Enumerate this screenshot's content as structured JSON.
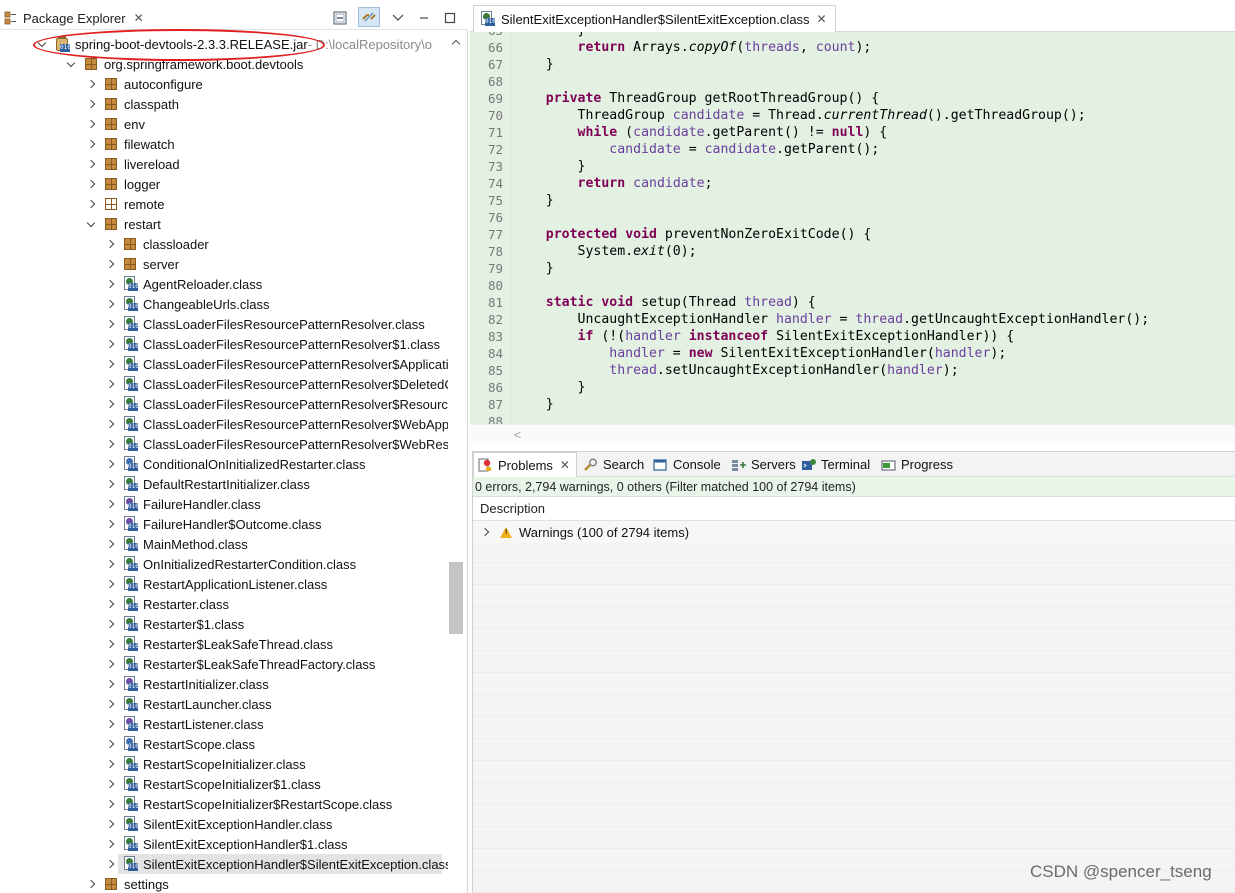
{
  "package_explorer": {
    "title": "Package Explorer",
    "tree": [
      {
        "label": "spring-boot-devtools-2.3.3.RELEASE.jar",
        "suffix": " - D:\\localRepository\\o",
        "icon": "jar-icon",
        "indent": 0,
        "expand": "down"
      },
      {
        "label": "org.springframework.boot.devtools",
        "icon": "package-icon",
        "indent": 1,
        "expand": "down"
      },
      {
        "label": "autoconfigure",
        "icon": "package-icon",
        "indent": 2,
        "expand": "right"
      },
      {
        "label": "classpath",
        "icon": "package-icon",
        "indent": 2,
        "expand": "right"
      },
      {
        "label": "env",
        "icon": "package-icon",
        "indent": 2,
        "expand": "right"
      },
      {
        "label": "filewatch",
        "icon": "package-icon",
        "indent": 2,
        "expand": "right"
      },
      {
        "label": "livereload",
        "icon": "package-icon",
        "indent": 2,
        "expand": "right"
      },
      {
        "label": "logger",
        "icon": "package-icon",
        "indent": 2,
        "expand": "right"
      },
      {
        "label": "remote",
        "icon": "package-empty-icon",
        "indent": 2,
        "expand": "right"
      },
      {
        "label": "restart",
        "icon": "package-icon",
        "indent": 2,
        "expand": "down"
      },
      {
        "label": "classloader",
        "icon": "package-icon",
        "indent": 3,
        "expand": "right"
      },
      {
        "label": "server",
        "icon": "package-icon",
        "indent": 3,
        "expand": "right"
      },
      {
        "label": "AgentReloader.class",
        "icon": "class-file-icon",
        "indent": 3,
        "expand": "right"
      },
      {
        "label": "ChangeableUrls.class",
        "icon": "class-file-icon",
        "indent": 3,
        "expand": "right"
      },
      {
        "label": "ClassLoaderFilesResourcePatternResolver.class",
        "icon": "class-file-icon",
        "indent": 3,
        "expand": "right"
      },
      {
        "label": "ClassLoaderFilesResourcePatternResolver$1.class",
        "icon": "class-file-icon",
        "indent": 3,
        "expand": "right"
      },
      {
        "label": "ClassLoaderFilesResourcePatternResolver$Applicatio",
        "icon": "class-file-icon",
        "indent": 3,
        "expand": "right"
      },
      {
        "label": "ClassLoaderFilesResourcePatternResolver$DeletedCl",
        "icon": "class-file-icon",
        "indent": 3,
        "expand": "right"
      },
      {
        "label": "ClassLoaderFilesResourcePatternResolver$Resource",
        "icon": "class-file-icon",
        "indent": 3,
        "expand": "right"
      },
      {
        "label": "ClassLoaderFilesResourcePatternResolver$WebAppli",
        "icon": "class-file-icon",
        "indent": 3,
        "expand": "right"
      },
      {
        "label": "ClassLoaderFilesResourcePatternResolver$WebReso",
        "icon": "class-file-icon",
        "indent": 3,
        "expand": "right"
      },
      {
        "label": "ConditionalOnInitializedRestarter.class",
        "icon": "annotation-file-icon",
        "indent": 3,
        "expand": "right"
      },
      {
        "label": "DefaultRestartInitializer.class",
        "icon": "class-file-icon",
        "indent": 3,
        "expand": "right"
      },
      {
        "label": "FailureHandler.class",
        "icon": "interface-file-icon",
        "indent": 3,
        "expand": "right"
      },
      {
        "label": "FailureHandler$Outcome.class",
        "icon": "interface-file-icon",
        "indent": 3,
        "expand": "right"
      },
      {
        "label": "MainMethod.class",
        "icon": "class-file-icon",
        "indent": 3,
        "expand": "right"
      },
      {
        "label": "OnInitializedRestarterCondition.class",
        "icon": "class-file-icon",
        "indent": 3,
        "expand": "right"
      },
      {
        "label": "RestartApplicationListener.class",
        "icon": "class-file-icon",
        "indent": 3,
        "expand": "right"
      },
      {
        "label": "Restarter.class",
        "icon": "class-file-icon",
        "indent": 3,
        "expand": "right"
      },
      {
        "label": "Restarter$1.class",
        "icon": "class-file-icon",
        "indent": 3,
        "expand": "right"
      },
      {
        "label": "Restarter$LeakSafeThread.class",
        "icon": "class-file-icon",
        "indent": 3,
        "expand": "right"
      },
      {
        "label": "Restarter$LeakSafeThreadFactory.class",
        "icon": "class-file-icon",
        "indent": 3,
        "expand": "right"
      },
      {
        "label": "RestartInitializer.class",
        "icon": "interface-file-icon",
        "indent": 3,
        "expand": "right"
      },
      {
        "label": "RestartLauncher.class",
        "icon": "class-file-icon",
        "indent": 3,
        "expand": "right"
      },
      {
        "label": "RestartListener.class",
        "icon": "interface-file-icon",
        "indent": 3,
        "expand": "right"
      },
      {
        "label": "RestartScope.class",
        "icon": "annotation-file-icon",
        "indent": 3,
        "expand": "right"
      },
      {
        "label": "RestartScopeInitializer.class",
        "icon": "class-file-icon",
        "indent": 3,
        "expand": "right"
      },
      {
        "label": "RestartScopeInitializer$1.class",
        "icon": "class-file-icon",
        "indent": 3,
        "expand": "right"
      },
      {
        "label": "RestartScopeInitializer$RestartScope.class",
        "icon": "class-file-icon",
        "indent": 3,
        "expand": "right"
      },
      {
        "label": "SilentExitExceptionHandler.class",
        "icon": "class-file-icon",
        "indent": 3,
        "expand": "right"
      },
      {
        "label": "SilentExitExceptionHandler$1.class",
        "icon": "class-file-icon",
        "indent": 3,
        "expand": "right"
      },
      {
        "label": "SilentExitExceptionHandler$SilentExitException.class",
        "icon": "class-file-icon",
        "indent": 3,
        "expand": "right",
        "selected": true
      },
      {
        "label": "settings",
        "icon": "package-icon",
        "indent": 2,
        "expand": "right"
      }
    ]
  },
  "editor": {
    "tab_title": "SilentExitExceptionHandler$SilentExitException.class",
    "lines": [
      {
        "n": "65",
        "tokens": [
          {
            "t": "        }",
            "c": ""
          }
        ]
      },
      {
        "n": "66",
        "tokens": [
          {
            "t": "        ",
            "c": ""
          },
          {
            "t": "return",
            "c": "kw"
          },
          {
            "t": " Arrays.",
            "c": ""
          },
          {
            "t": "copyOf",
            "c": "it"
          },
          {
            "t": "(",
            "c": ""
          },
          {
            "t": "threads",
            "c": "fld"
          },
          {
            "t": ", ",
            "c": ""
          },
          {
            "t": "count",
            "c": "fld"
          },
          {
            "t": ");",
            "c": ""
          }
        ]
      },
      {
        "n": "67",
        "tokens": [
          {
            "t": "    }",
            "c": ""
          }
        ]
      },
      {
        "n": "68",
        "tokens": [
          {
            "t": "",
            "c": ""
          }
        ]
      },
      {
        "n": "69",
        "tokens": [
          {
            "t": "    ",
            "c": ""
          },
          {
            "t": "private",
            "c": "kw"
          },
          {
            "t": " ThreadGroup getRootThreadGroup() {",
            "c": ""
          }
        ]
      },
      {
        "n": "70",
        "tokens": [
          {
            "t": "        ThreadGroup ",
            "c": ""
          },
          {
            "t": "candidate",
            "c": "fld"
          },
          {
            "t": " = Thread.",
            "c": ""
          },
          {
            "t": "currentThread",
            "c": "it"
          },
          {
            "t": "().getThreadGroup();",
            "c": ""
          }
        ]
      },
      {
        "n": "71",
        "tokens": [
          {
            "t": "        ",
            "c": ""
          },
          {
            "t": "while",
            "c": "kw"
          },
          {
            "t": " (",
            "c": ""
          },
          {
            "t": "candidate",
            "c": "fld"
          },
          {
            "t": ".getParent() != ",
            "c": ""
          },
          {
            "t": "null",
            "c": "kw"
          },
          {
            "t": ") {",
            "c": ""
          }
        ]
      },
      {
        "n": "72",
        "tokens": [
          {
            "t": "            ",
            "c": ""
          },
          {
            "t": "candidate",
            "c": "fld"
          },
          {
            "t": " = ",
            "c": ""
          },
          {
            "t": "candidate",
            "c": "fld"
          },
          {
            "t": ".getParent();",
            "c": ""
          }
        ]
      },
      {
        "n": "73",
        "tokens": [
          {
            "t": "        }",
            "c": ""
          }
        ]
      },
      {
        "n": "74",
        "tokens": [
          {
            "t": "        ",
            "c": ""
          },
          {
            "t": "return",
            "c": "kw"
          },
          {
            "t": " ",
            "c": ""
          },
          {
            "t": "candidate",
            "c": "fld"
          },
          {
            "t": ";",
            "c": ""
          }
        ]
      },
      {
        "n": "75",
        "tokens": [
          {
            "t": "    }",
            "c": ""
          }
        ]
      },
      {
        "n": "76",
        "tokens": [
          {
            "t": "",
            "c": ""
          }
        ]
      },
      {
        "n": "77",
        "tokens": [
          {
            "t": "    ",
            "c": ""
          },
          {
            "t": "protected",
            "c": "kw"
          },
          {
            "t": " ",
            "c": ""
          },
          {
            "t": "void",
            "c": "kw"
          },
          {
            "t": " preventNonZeroExitCode() {",
            "c": ""
          }
        ]
      },
      {
        "n": "78",
        "tokens": [
          {
            "t": "        System.",
            "c": ""
          },
          {
            "t": "exit",
            "c": "it"
          },
          {
            "t": "(0);",
            "c": ""
          }
        ]
      },
      {
        "n": "79",
        "tokens": [
          {
            "t": "    }",
            "c": ""
          }
        ]
      },
      {
        "n": "80",
        "tokens": [
          {
            "t": "",
            "c": ""
          }
        ]
      },
      {
        "n": "81",
        "tokens": [
          {
            "t": "    ",
            "c": ""
          },
          {
            "t": "static",
            "c": "kw"
          },
          {
            "t": " ",
            "c": ""
          },
          {
            "t": "void",
            "c": "kw"
          },
          {
            "t": " setup(Thread ",
            "c": ""
          },
          {
            "t": "thread",
            "c": "fld"
          },
          {
            "t": ") {",
            "c": ""
          }
        ]
      },
      {
        "n": "82",
        "tokens": [
          {
            "t": "        UncaughtExceptionHandler ",
            "c": ""
          },
          {
            "t": "handler",
            "c": "fld"
          },
          {
            "t": " = ",
            "c": ""
          },
          {
            "t": "thread",
            "c": "fld"
          },
          {
            "t": ".getUncaughtExceptionHandler();",
            "c": ""
          }
        ]
      },
      {
        "n": "83",
        "tokens": [
          {
            "t": "        ",
            "c": ""
          },
          {
            "t": "if",
            "c": "kw"
          },
          {
            "t": " (!(",
            "c": ""
          },
          {
            "t": "handler",
            "c": "fld"
          },
          {
            "t": " ",
            "c": ""
          },
          {
            "t": "instanceof",
            "c": "kw"
          },
          {
            "t": " SilentExitExceptionHandler)) {",
            "c": ""
          }
        ]
      },
      {
        "n": "84",
        "tokens": [
          {
            "t": "            ",
            "c": ""
          },
          {
            "t": "handler",
            "c": "fld"
          },
          {
            "t": " = ",
            "c": ""
          },
          {
            "t": "new",
            "c": "kw"
          },
          {
            "t": " SilentExitExceptionHandler(",
            "c": ""
          },
          {
            "t": "handler",
            "c": "fld"
          },
          {
            "t": ");",
            "c": ""
          }
        ]
      },
      {
        "n": "85",
        "tokens": [
          {
            "t": "            ",
            "c": ""
          },
          {
            "t": "thread",
            "c": "fld"
          },
          {
            "t": ".setUncaughtExceptionHandler(",
            "c": ""
          },
          {
            "t": "handler",
            "c": "fld"
          },
          {
            "t": ");",
            "c": ""
          }
        ]
      },
      {
        "n": "86",
        "tokens": [
          {
            "t": "        }",
            "c": ""
          }
        ]
      },
      {
        "n": "87",
        "tokens": [
          {
            "t": "    }",
            "c": ""
          }
        ]
      },
      {
        "n": "88",
        "tokens": [
          {
            "t": "",
            "c": ""
          }
        ]
      }
    ]
  },
  "bottom_panel": {
    "tabs": [
      {
        "label": "Problems",
        "icon": "problems-icon",
        "active": true
      },
      {
        "label": "Search",
        "icon": "search-icon"
      },
      {
        "label": "Console",
        "icon": "console-icon"
      },
      {
        "label": "Servers",
        "icon": "servers-icon"
      },
      {
        "label": "Terminal",
        "icon": "terminal-icon"
      },
      {
        "label": "Progress",
        "icon": "progress-icon"
      }
    ],
    "status": "0 errors, 2,794 warnings, 0 others (Filter matched 100 of 2794 items)",
    "column_header": "Description",
    "warnings_row": "Warnings (100 of 2794 items)"
  },
  "watermark": "CSDN @spencer_tseng",
  "colors": {
    "editor_bg": "#e3f1e3",
    "keyword": "#7f0055",
    "field": "#6a3e9d",
    "annotation_circle": "#e02020",
    "selection": "#e3e3e3"
  }
}
